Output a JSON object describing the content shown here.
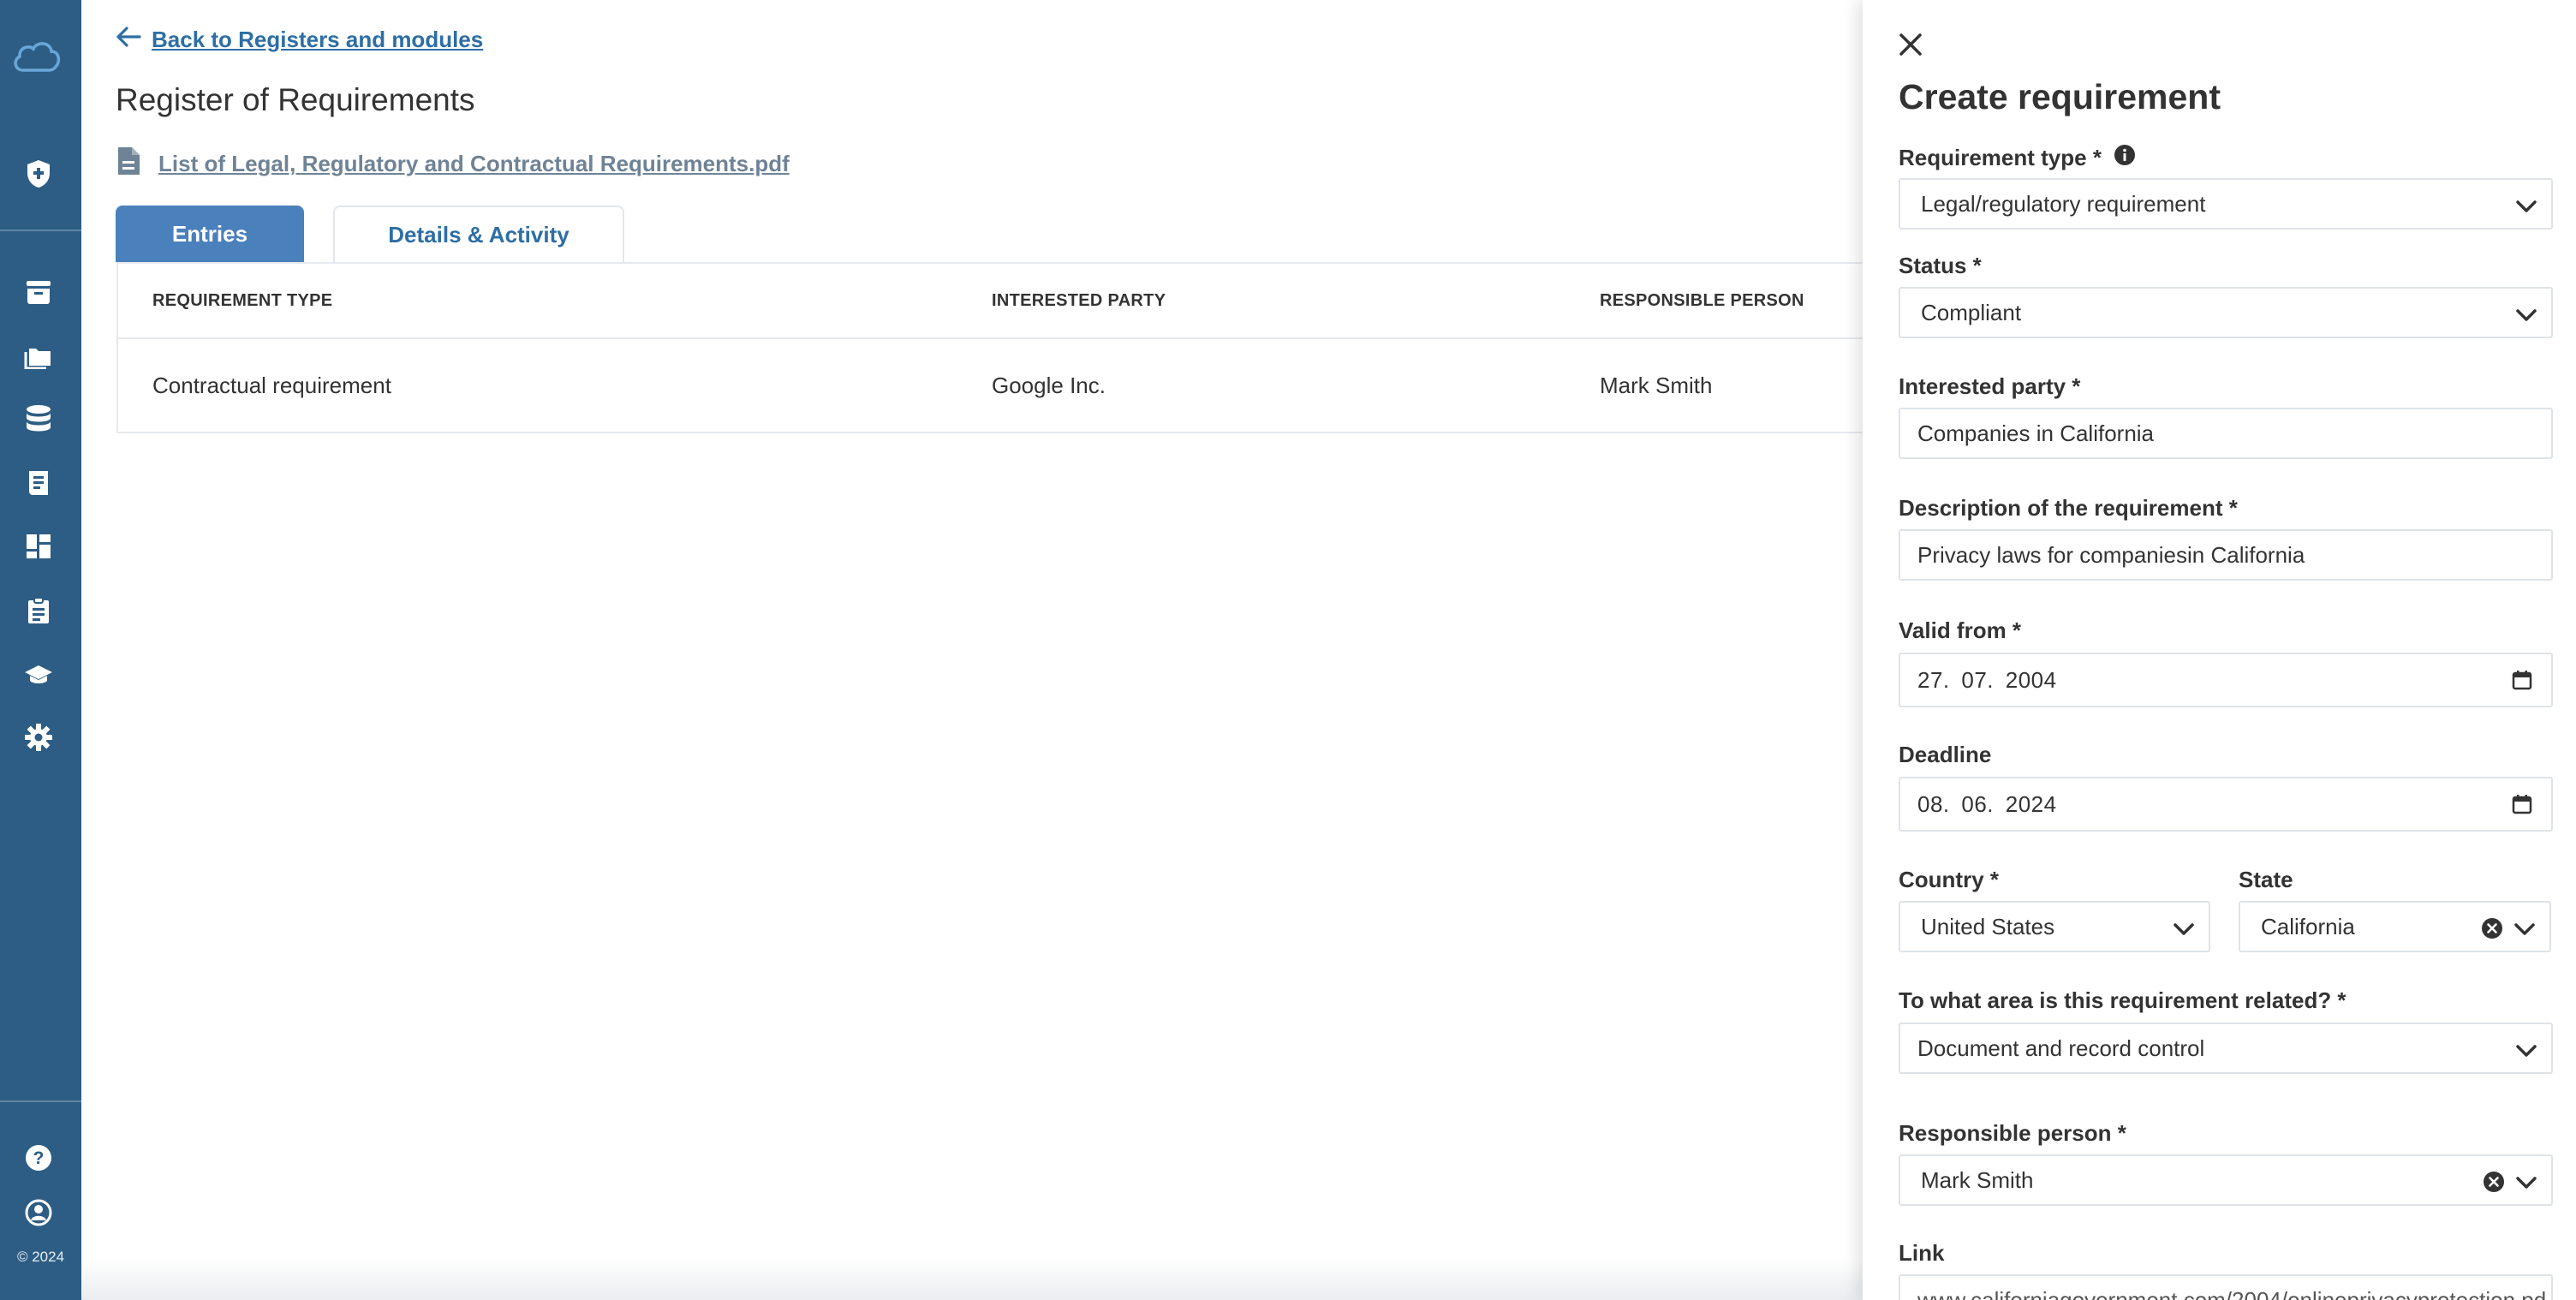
{
  "sidebar": {
    "copyright": "© 2024"
  },
  "main": {
    "back_link": "Back to Registers and modules",
    "title": "Register of Requirements",
    "file_link": "List of Legal, Regulatory and Contractual Requirements.pdf",
    "tabs": [
      {
        "label": "Entries",
        "active": true
      },
      {
        "label": "Details & Activity",
        "active": false
      }
    ],
    "table": {
      "headers": [
        "REQUIREMENT TYPE",
        "INTERESTED PARTY",
        "RESPONSIBLE PERSON"
      ],
      "rows": [
        [
          "Contractual requirement",
          "Google Inc.",
          "Mark Smith"
        ]
      ]
    }
  },
  "panel": {
    "title": "Create requirement",
    "requirement_type": {
      "label": "Requirement type *",
      "value": "Legal/regulatory requirement"
    },
    "status": {
      "label": "Status *",
      "value": "Compliant"
    },
    "interested_party": {
      "label": "Interested party *",
      "value": "Companies in California"
    },
    "description": {
      "label": "Description of the requirement *",
      "value": "Privacy laws for companiesin California"
    },
    "valid_from": {
      "label": "Valid from *",
      "value": "27. 07. 2004"
    },
    "deadline": {
      "label": "Deadline",
      "value": "08. 06. 2024"
    },
    "country": {
      "label": "Country *",
      "value": "United States"
    },
    "state": {
      "label": "State",
      "value": "California"
    },
    "area": {
      "label": "To what area is this requirement related? *",
      "value": "Document and record control"
    },
    "responsible_person": {
      "label": "Responsible person *",
      "value": "Mark Smith"
    },
    "link": {
      "label": "Link",
      "value": "www.californiagovernment.com/2004/onlineprivacyprotection.pd"
    }
  },
  "colors": {
    "sidebar": "#2d5d84",
    "accent": "#4a80bb",
    "link": "#2d6ea5"
  }
}
